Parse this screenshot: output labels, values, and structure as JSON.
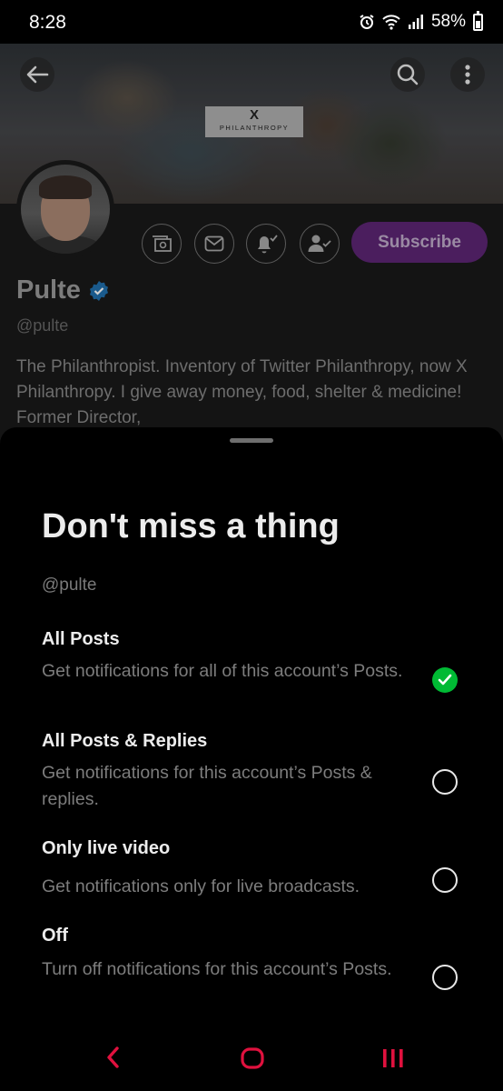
{
  "status_bar": {
    "time": "8:28",
    "battery": "58%"
  },
  "banner": {
    "logo_x": "X",
    "logo_text": "PHILANTHROPY"
  },
  "profile": {
    "name": "Pulte",
    "handle": "@pulte",
    "bio": "The Philanthropist. Inventory of Twitter Philanthropy, now X Philanthropy. I give away money, food, shelter & medicine! Former Director,",
    "subscribe_label": "Subscribe"
  },
  "sheet": {
    "title": "Don't miss a thing",
    "handle": "@pulte",
    "options": [
      {
        "title": "All Posts",
        "description": "Get notifications for all of this account’s Posts.",
        "selected": true
      },
      {
        "title": "All Posts & Replies",
        "description": "Get notifications for this account’s Posts & replies.",
        "selected": false
      },
      {
        "title": "Only live video",
        "description": "Get notifications only for live broadcasts.",
        "selected": false
      },
      {
        "title": "Off",
        "description": "Turn off notifications for this account’s Posts.",
        "selected": false
      }
    ]
  },
  "colors": {
    "selected_green": "#00ba34",
    "subscribe_purple": "#4b1e5e",
    "nav_red": "#e0113e",
    "verified_blue": "#1d9bf0"
  },
  "icons": [
    "alarm-icon",
    "wifi-icon",
    "signal-icon",
    "battery-icon",
    "back-arrow-icon",
    "search-icon",
    "more-options-icon",
    "tip-icon",
    "message-icon",
    "bell-check-icon",
    "person-check-icon",
    "verified-badge-icon",
    "check-icon",
    "nav-back-icon",
    "nav-home-icon",
    "nav-recents-icon"
  ]
}
